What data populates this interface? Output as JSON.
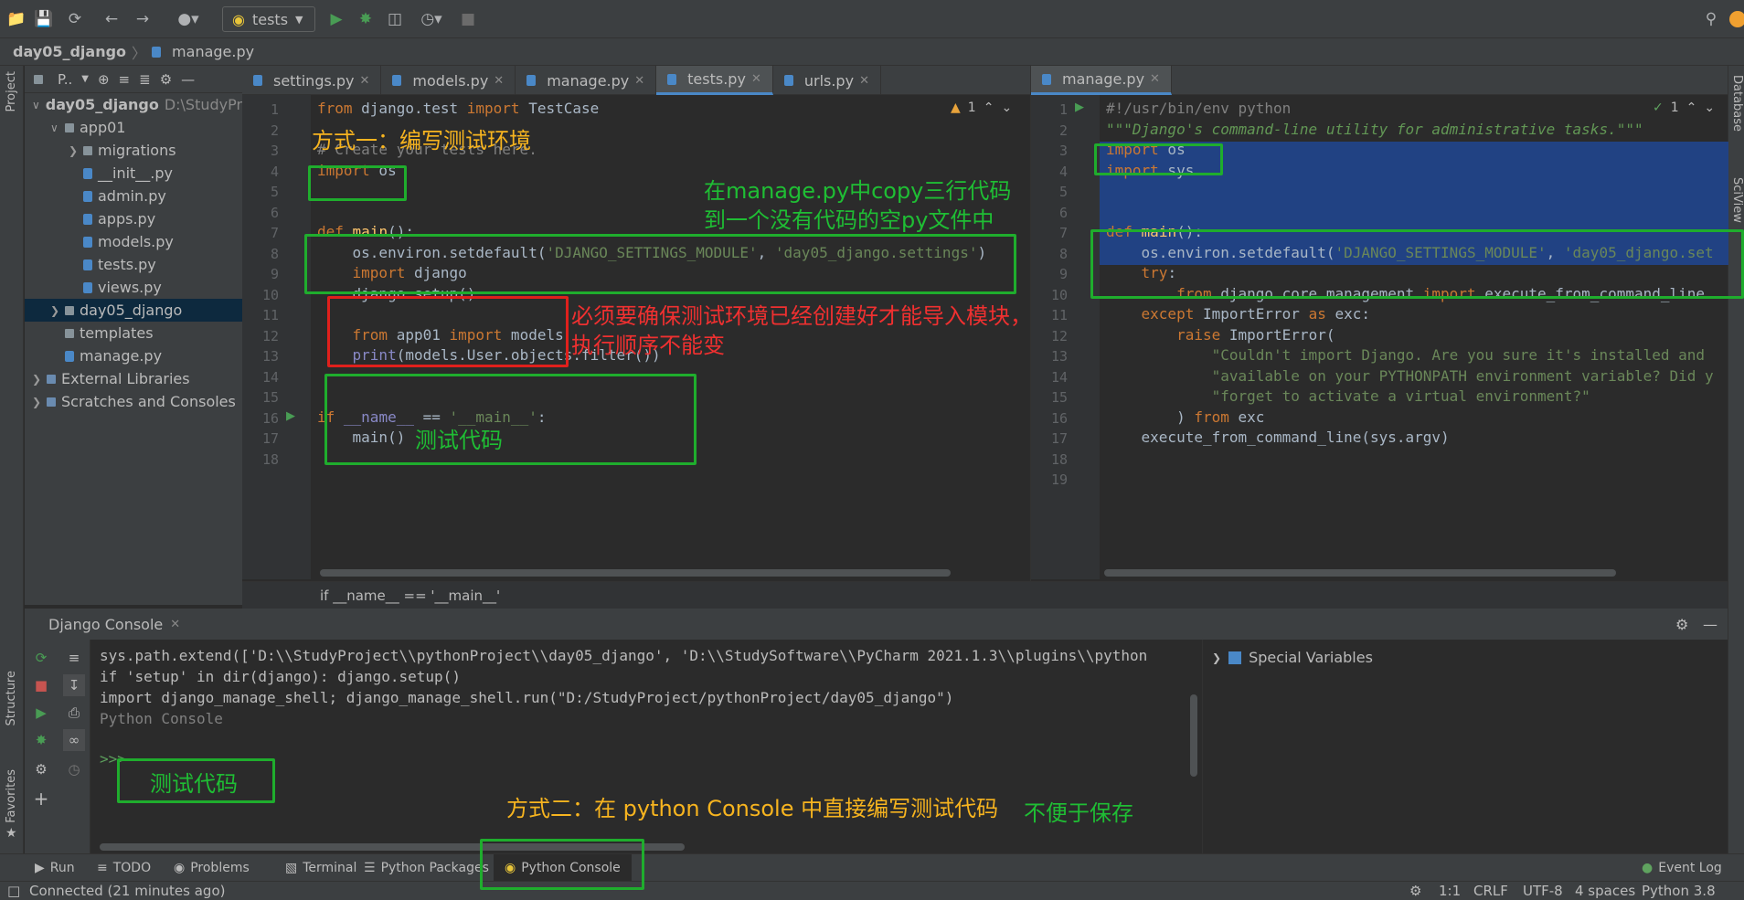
{
  "toolbar": {
    "run_config": "tests",
    "icons": [
      "open-folder-icon",
      "save-icon",
      "sync-icon",
      "back-icon",
      "forward-icon",
      "user-icon",
      "python-icon",
      "run-icon",
      "debug-icon",
      "coverage-icon",
      "profile-icon",
      "stop-icon",
      "search-icon",
      "update-icon"
    ]
  },
  "navbar": {
    "project": "day05_django",
    "file": "manage.py"
  },
  "side_tabs": {
    "left": [
      "Project",
      "Structure",
      "Favorites"
    ],
    "right": [
      "Database",
      "SciView"
    ]
  },
  "project": {
    "header": "P..",
    "tree": [
      {
        "label": "day05_django",
        "suffix": "D:\\StudyPr",
        "type": "folder",
        "level": 0,
        "open": true
      },
      {
        "label": "app01",
        "type": "folder",
        "level": 1,
        "open": true
      },
      {
        "label": "migrations",
        "type": "folder",
        "level": 2,
        "open": false
      },
      {
        "label": "__init__.py",
        "type": "py",
        "level": 2
      },
      {
        "label": "admin.py",
        "type": "py",
        "level": 2
      },
      {
        "label": "apps.py",
        "type": "py",
        "level": 2
      },
      {
        "label": "models.py",
        "type": "py",
        "level": 2
      },
      {
        "label": "tests.py",
        "type": "py",
        "level": 2
      },
      {
        "label": "views.py",
        "type": "py",
        "level": 2
      },
      {
        "label": "day05_django",
        "type": "folder",
        "level": 1,
        "open": false,
        "selected": true
      },
      {
        "label": "templates",
        "type": "folder",
        "level": 1
      },
      {
        "label": "manage.py",
        "type": "py",
        "level": 1
      },
      {
        "label": "External Libraries",
        "type": "lib",
        "level": 0,
        "open": false
      },
      {
        "label": "Scratches and Consoles",
        "type": "lib",
        "level": 0,
        "open": false
      }
    ]
  },
  "editor_left": {
    "tabs": [
      "settings.py",
      "models.py",
      "manage.py",
      "tests.py",
      "urls.py"
    ],
    "active_tab": "tests.py",
    "warning_count": "1",
    "lines": [
      {
        "n": "1",
        "t": "from django.test import TestCase"
      },
      {
        "n": "2",
        "t": ""
      },
      {
        "n": "3",
        "t": "# Create your tests here."
      },
      {
        "n": "4",
        "t": "import os"
      },
      {
        "n": "5",
        "t": ""
      },
      {
        "n": "6",
        "t": ""
      },
      {
        "n": "7",
        "t": "def main():"
      },
      {
        "n": "8",
        "t": "    os.environ.setdefault('DJANGO_SETTINGS_MODULE', 'day05_django.settings')"
      },
      {
        "n": "9",
        "t": "    import django"
      },
      {
        "n": "10",
        "t": "    django.setup()"
      },
      {
        "n": "11",
        "t": ""
      },
      {
        "n": "12",
        "t": "    from app01 import models"
      },
      {
        "n": "13",
        "t": "    print(models.User.objects.filter())"
      },
      {
        "n": "14",
        "t": ""
      },
      {
        "n": "15",
        "t": ""
      },
      {
        "n": "16",
        "t": "if __name__ == '__main__':"
      },
      {
        "n": "17",
        "t": "    main()"
      },
      {
        "n": "18",
        "t": ""
      }
    ],
    "breadcrumb": "if __name__ == '__main__'"
  },
  "editor_right": {
    "tab": "manage.py",
    "warning_count": "1",
    "lines": [
      {
        "n": "1",
        "t": "#!/usr/bin/env python"
      },
      {
        "n": "2",
        "t": "\"\"\"Django's command-line utility for administrative tasks.\"\"\""
      },
      {
        "n": "3",
        "t": "import os"
      },
      {
        "n": "4",
        "t": "import sys"
      },
      {
        "n": "5",
        "t": ""
      },
      {
        "n": "6",
        "t": ""
      },
      {
        "n": "7",
        "t": "def main():"
      },
      {
        "n": "8",
        "t": "    os.environ.setdefault('DJANGO_SETTINGS_MODULE', 'day05_django.set"
      },
      {
        "n": "9",
        "t": "    try:"
      },
      {
        "n": "10",
        "t": "        from django.core.management import execute_from_command_line"
      },
      {
        "n": "11",
        "t": "    except ImportError as exc:"
      },
      {
        "n": "12",
        "t": "        raise ImportError("
      },
      {
        "n": "13",
        "t": "            \"Couldn't import Django. Are you sure it's installed and"
      },
      {
        "n": "14",
        "t": "            \"available on your PYTHONPATH environment variable? Did y"
      },
      {
        "n": "15",
        "t": "            \"forget to activate a virtual environment?\""
      },
      {
        "n": "16",
        "t": "        ) from exc"
      },
      {
        "n": "17",
        "t": "    execute_from_command_line(sys.argv)"
      },
      {
        "n": "18",
        "t": ""
      },
      {
        "n": "19",
        "t": ""
      }
    ]
  },
  "console": {
    "title": "Django Console",
    "lines": [
      "sys.path.extend(['D:\\\\StudyProject\\\\pythonProject\\\\day05_django', 'D:\\\\StudySoftware\\\\PyCharm 2021.1.3\\\\plugins\\\\python",
      "if 'setup' in dir(django): django.setup()",
      "import django_manage_shell; django_manage_shell.run(\"D:/StudyProject/pythonProject/day05_django\")",
      "Python Console"
    ],
    "prompt": ">>>",
    "special_variables": "Special Variables"
  },
  "tool_tabs": [
    "Run",
    "TODO",
    "Problems",
    "Terminal",
    "Python Packages",
    "Python Console",
    "Event Log"
  ],
  "status": {
    "left": "Connected (21 minutes ago)",
    "position": "1:1",
    "line_sep": "CRLF",
    "encoding": "UTF-8",
    "indent": "4 spaces",
    "interpreter": "Python 3.8"
  },
  "annotations": {
    "method1": "方式一：编写测试环境",
    "copy1": "在manage.py中copy三行代码",
    "copy2": "到一个没有代码的空py文件中",
    "must1": "必须要确保测试环境已经创建好才能导入模块，",
    "must2": "执行顺序不能变",
    "test_code": "测试代码",
    "console_test_code": "测试代码",
    "method2": "方式二：在 python Console 中直接编写测试代码",
    "inconvenient": "不便于保存"
  },
  "colors": {
    "annotation_green": "#1fad2d",
    "annotation_red": "#e0201c",
    "annotation_yellow": "#f7b41f",
    "selection": "#214283"
  }
}
